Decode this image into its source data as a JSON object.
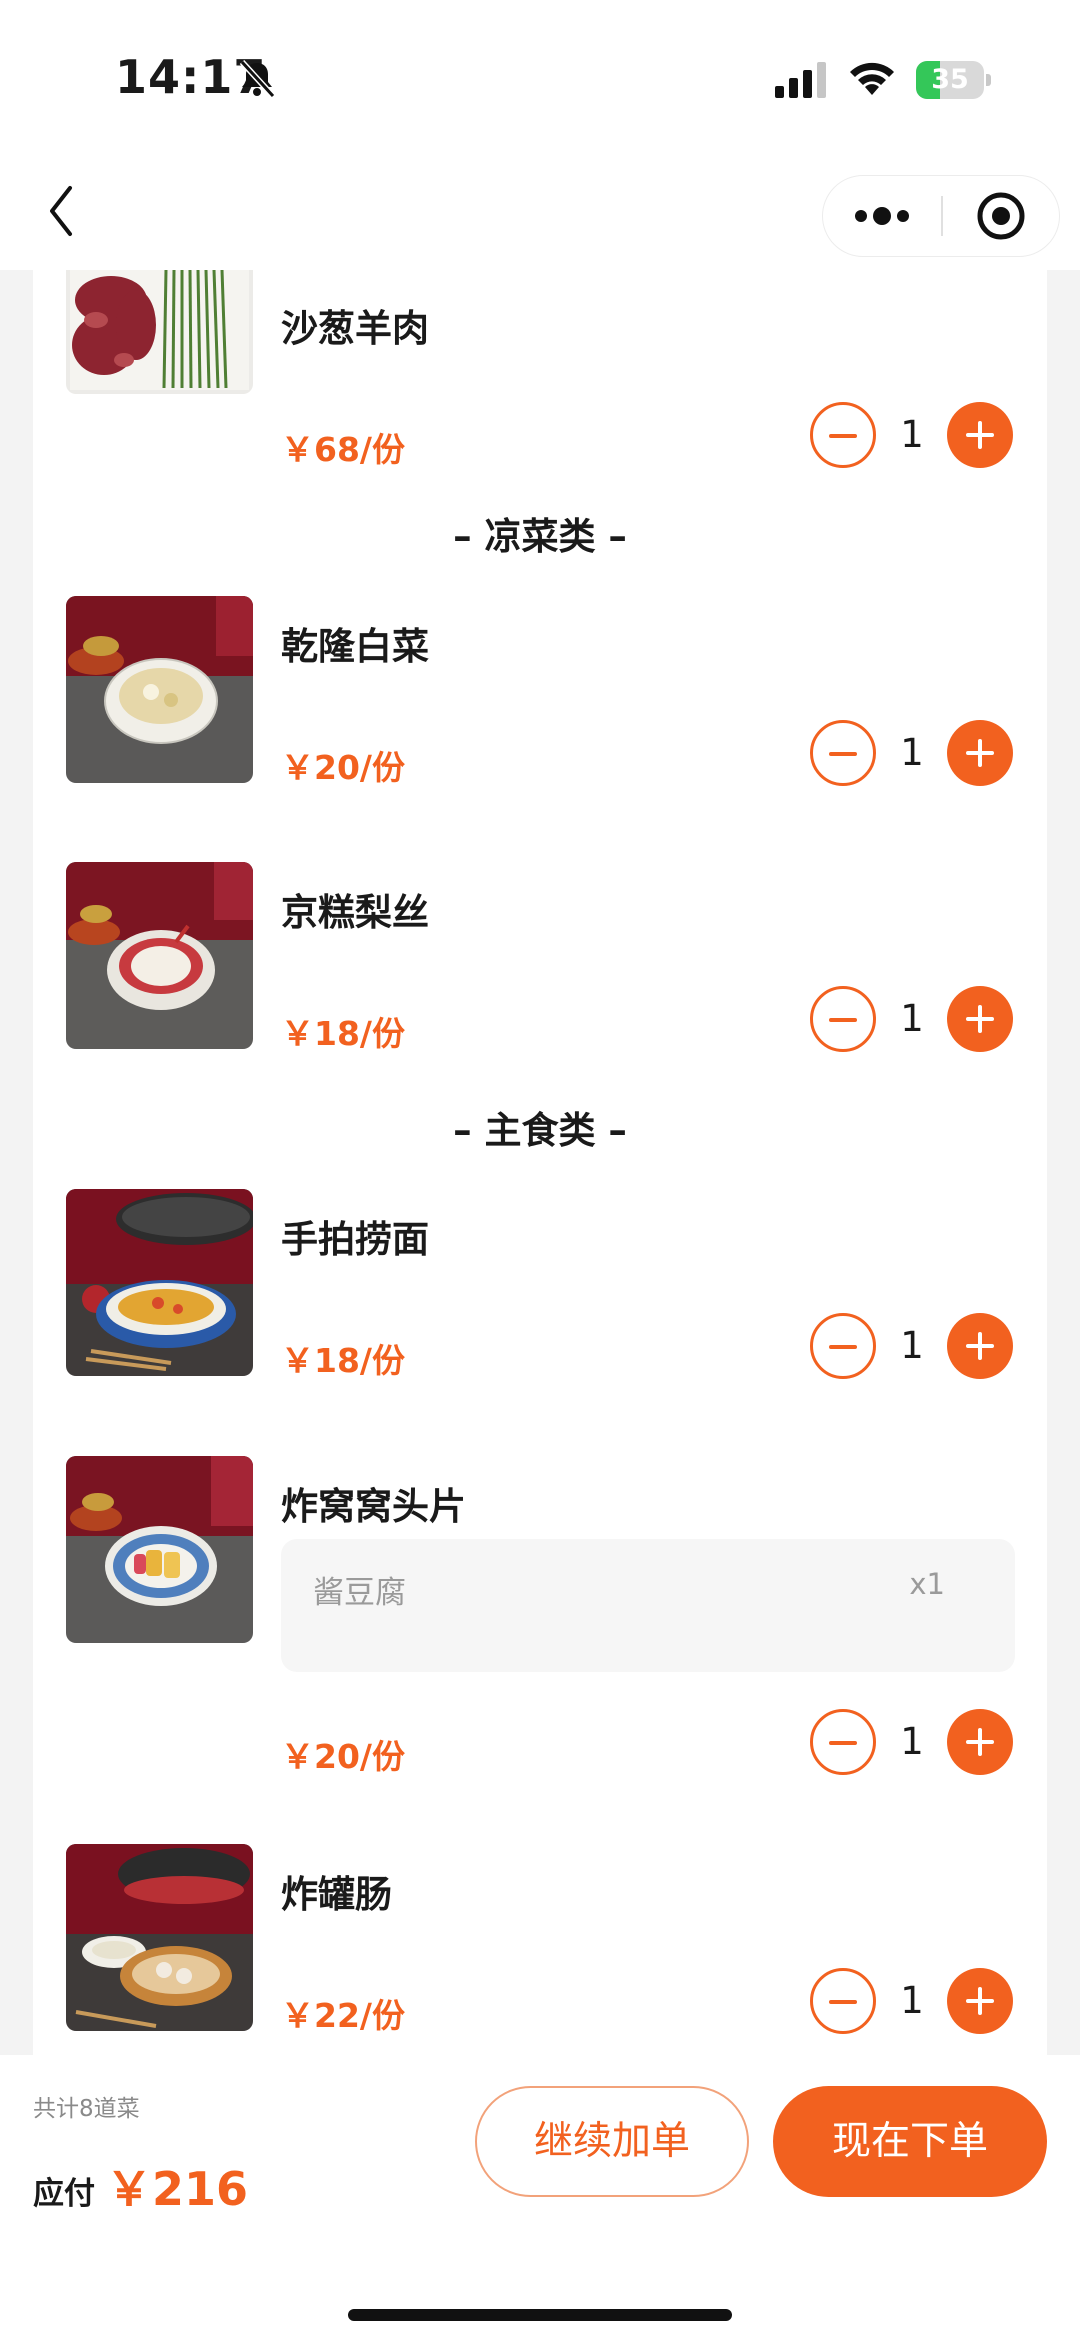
{
  "status_bar": {
    "time": "14:17",
    "battery_level": "35",
    "battery_fraction": 0.35,
    "signal_bars": 3,
    "icons": [
      "bell-off-icon",
      "signal-icon",
      "wifi-icon",
      "battery-charging-icon"
    ]
  },
  "nav": {
    "icons": [
      "back-icon",
      "more-icon",
      "close-target-icon"
    ]
  },
  "categories": {
    "cold": "– 凉菜类 –",
    "staple": "– 主食类 –"
  },
  "dishes": [
    {
      "name": "沙葱羊肉",
      "price": "￥68/份",
      "qty": "1"
    },
    {
      "name": "乾隆白菜",
      "price": "￥20/份",
      "qty": "1"
    },
    {
      "name": "京糕梨丝",
      "price": "￥18/份",
      "qty": "1"
    },
    {
      "name": "手拍捞面",
      "price": "￥18/份",
      "qty": "1"
    },
    {
      "name": "炸窝窝头片",
      "price": "￥20/份",
      "qty": "1",
      "option": {
        "name": "酱豆腐",
        "qty": "x1"
      }
    },
    {
      "name": "炸罐肠",
      "price": "￥22/份",
      "qty": "1"
    }
  ],
  "footer": {
    "count_text": "共计8道菜",
    "pay_label": "应付",
    "pay_amount": "￥216",
    "continue_label": "继续加单",
    "order_label": "现在下单"
  },
  "colors": {
    "accent": "#f2611f",
    "battery": "#34c759",
    "page_bg": "#f3f3f3"
  }
}
